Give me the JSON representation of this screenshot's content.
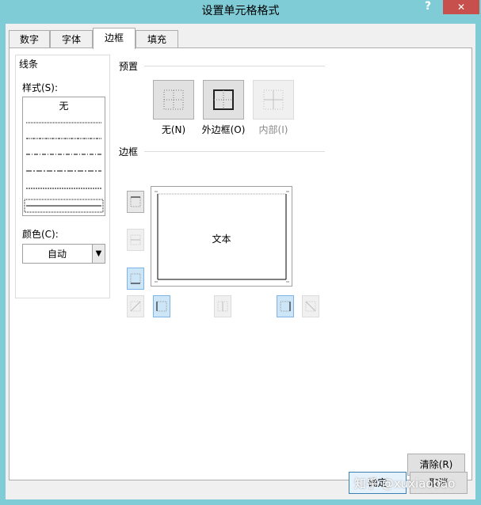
{
  "window": {
    "title": "设置单元格格式",
    "help_label": "?",
    "close_label": "✕"
  },
  "tabs": [
    {
      "label": "数字",
      "active": false
    },
    {
      "label": "字体",
      "active": false
    },
    {
      "label": "边框",
      "active": true
    },
    {
      "label": "填充",
      "active": false
    }
  ],
  "lines_group": {
    "title": "线条",
    "style_label": "样式(S):",
    "style_none": "无",
    "color_label": "颜色(C):",
    "color_value": "自动"
  },
  "presets": {
    "title": "预置",
    "items": [
      {
        "label": "无(N)",
        "enabled": true
      },
      {
        "label": "外边框(O)",
        "enabled": true
      },
      {
        "label": "内部(I)",
        "enabled": false
      }
    ]
  },
  "border": {
    "title": "边框",
    "preview_text": "文本"
  },
  "buttons": {
    "clear": "清除(R)",
    "ok": "确定",
    "cancel": "取消"
  },
  "watermark": "知乎 @xuxiaobao",
  "colors": {
    "titlebar": "#7fcbd6",
    "close": "#c7504c",
    "selected_toggle": "#cde6f7"
  }
}
